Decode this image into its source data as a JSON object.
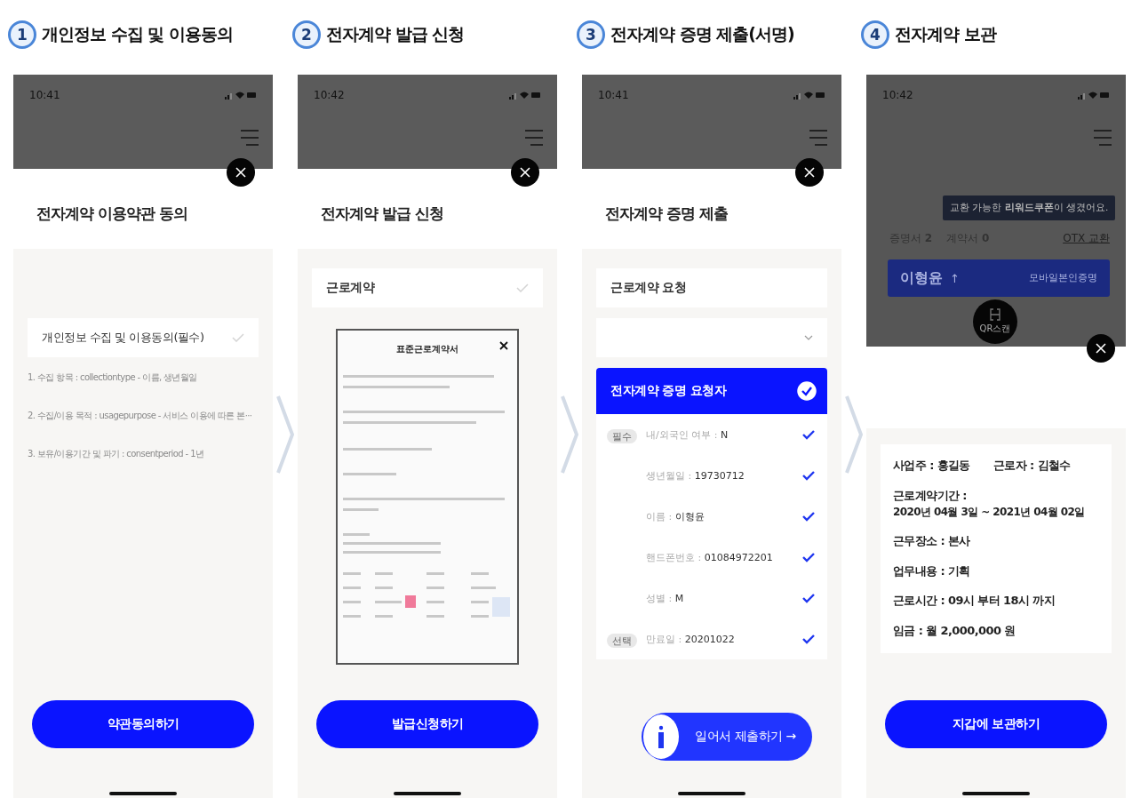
{
  "steps": [
    {
      "number": "1",
      "title": "개인정보 수집 및 이용동의",
      "screen": {
        "kind": "terms",
        "time": "10:41",
        "heading": "전자계약 이용약관 동의",
        "agreement": {
          "label": "개인정보 수집 및 이용동의(필수)",
          "checked": false
        },
        "items": [
          "1. 수집 항목 : collectiontype - 이름, 생년월일",
          "2. 수집/이용 목적 : usagepurpose - 서비스 이용에 따른 본···",
          "3. 보유/이용기간 및 파기 : consentperiod - 1년"
        ],
        "button": "약관동의하기"
      }
    },
    {
      "number": "2",
      "title": "전자계약 발급 신청",
      "screen": {
        "kind": "issue",
        "time": "10:42",
        "heading": "전자계약 발급 신청",
        "contract_type": {
          "label": "근로계약",
          "checked": false
        },
        "document_title": "표준근로계약서",
        "button": "발급신청하기"
      }
    },
    {
      "number": "3",
      "title": "전자계약 증명 제출(서명)",
      "screen": {
        "kind": "submit",
        "time": "10:41",
        "heading": "전자계약 증명 제출",
        "request_field": "근로계약 요청",
        "requester": {
          "label": "전자계약 증명 요청자",
          "checked": true
        },
        "fields": [
          {
            "badge": "필수",
            "label": "내/외국인 여부 : ",
            "value": "N",
            "checked": true
          },
          {
            "label": "생년월일 : ",
            "value": "19730712",
            "checked": true
          },
          {
            "label": "이름 : ",
            "value": "이형윤",
            "checked": true
          },
          {
            "label": "핸드폰번호 : ",
            "value": "01084972201",
            "checked": true
          },
          {
            "label": "성별 : ",
            "value": "M",
            "checked": true
          },
          {
            "badge": "선택",
            "label": "만료일 : ",
            "value": "20201022",
            "checked": true
          }
        ],
        "button": "일어서 제출하기",
        "button_arrow": "→"
      }
    },
    {
      "number": "4",
      "title": "전자계약 보관",
      "screen": {
        "kind": "wallet",
        "time": "10:42",
        "tooltip": "교환 가능한 **리워드쿠폰**이 생겼어요.",
        "counts": [
          "증명서 **2**",
          "계약서 **0**"
        ],
        "exchange_link": "OTX 교환",
        "card_name": "이형윤",
        "card_arrow": "↑",
        "card_label": "모바일본인증명",
        "qr_label": "QR스캔",
        "contract_lines": [
          [
            "사업주 : 홍길동",
            "근로자 : 김철수"
          ],
          [
            "근로계약기간 :",
            "2020년 04월 3일 ~ 2021년 04월 02일"
          ],
          [
            "근무장소 : 본사"
          ],
          [
            "업무내용 : 기획"
          ],
          [
            "근로시간 : 09시 부터 18시 까지"
          ],
          [
            "임금 : 월 2,000,000 원"
          ]
        ],
        "button": "지갑에 보관하기"
      }
    }
  ]
}
